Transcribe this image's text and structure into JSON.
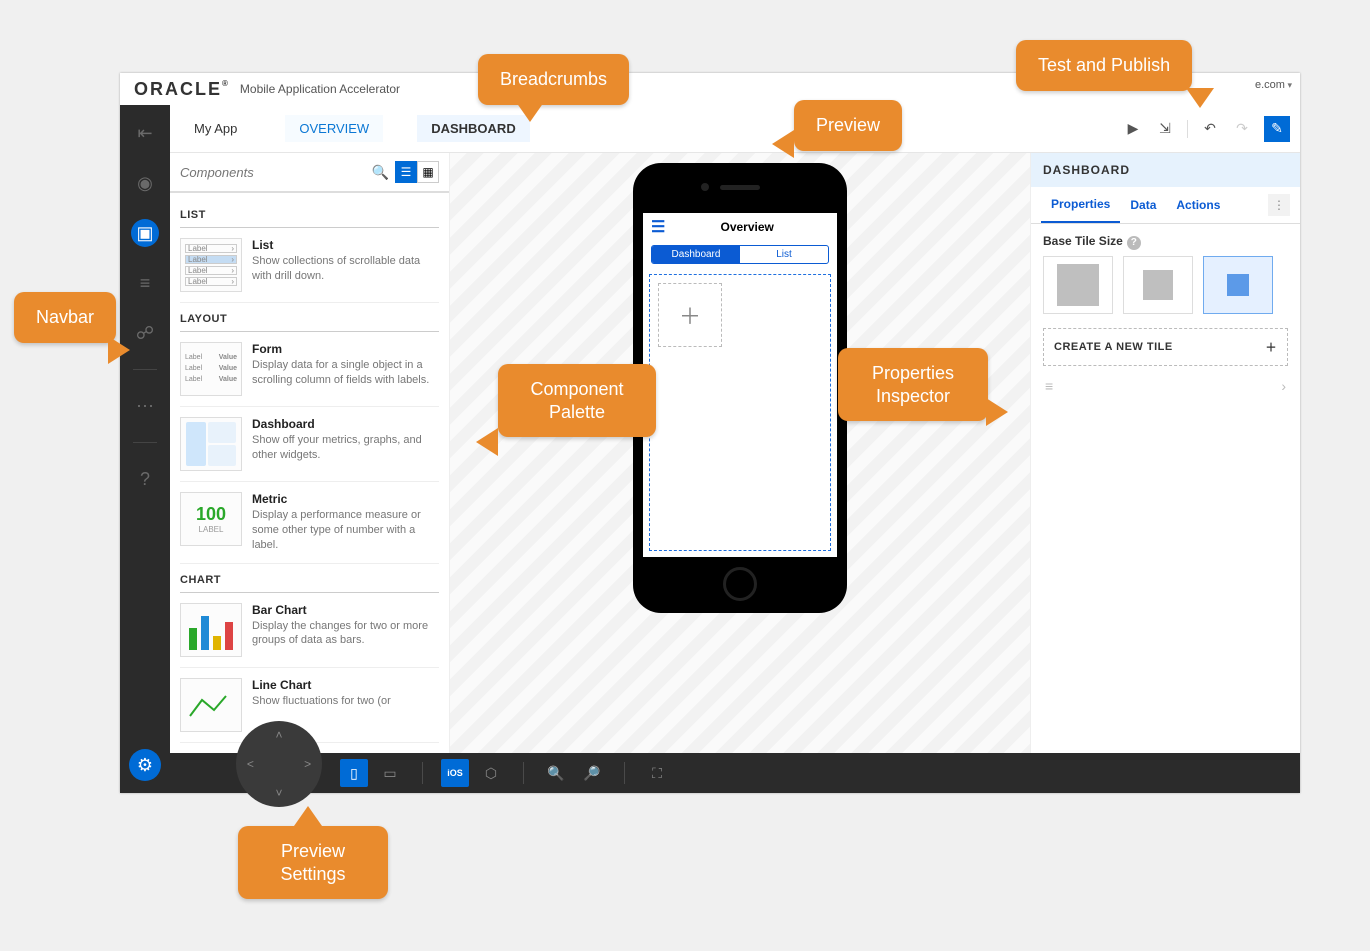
{
  "brand": {
    "logo": "ORACLE",
    "sub": "Mobile Application Accelerator"
  },
  "user": {
    "label": "e.com"
  },
  "breadcrumb": {
    "root": "My App",
    "link": "OVERVIEW",
    "current": "DASHBOARD"
  },
  "palette": {
    "search_placeholder": "Components",
    "sections": {
      "list": "LIST",
      "layout": "LAYOUT",
      "chart": "CHART"
    },
    "items": {
      "list": {
        "title": "List",
        "desc": "Show collections of scrollable data with drill down."
      },
      "form": {
        "title": "Form",
        "desc": "Display data for a single object in a scrolling column of fields with labels."
      },
      "dashboard": {
        "title": "Dashboard",
        "desc": "Show off your metrics, graphs, and other widgets."
      },
      "metric": {
        "title": "Metric",
        "desc": "Display a performance measure or some other type of number with a label.",
        "num": "100",
        "lbl": "LABEL"
      },
      "bar": {
        "title": "Bar Chart",
        "desc": "Display the changes for two or more groups of data as bars."
      },
      "line": {
        "title": "Line Chart",
        "desc": "Show fluctuations for two (or"
      }
    },
    "thumb_list_label": "Label"
  },
  "preview": {
    "title": "Overview",
    "seg_on": "Dashboard",
    "seg_off": "List"
  },
  "inspector": {
    "title": "DASHBOARD",
    "tabs": {
      "properties": "Properties",
      "data": "Data",
      "actions": "Actions"
    },
    "base_tile": "Base Tile Size",
    "new_tile": "CREATE A NEW TILE"
  },
  "callouts": {
    "breadcrumbs": "Breadcrumbs",
    "testpub": "Test and Publish",
    "preview": "Preview",
    "navbar": "Navbar",
    "palette": "Component Palette",
    "inspector": "Properties Inspector",
    "prevset": "Preview Settings"
  }
}
